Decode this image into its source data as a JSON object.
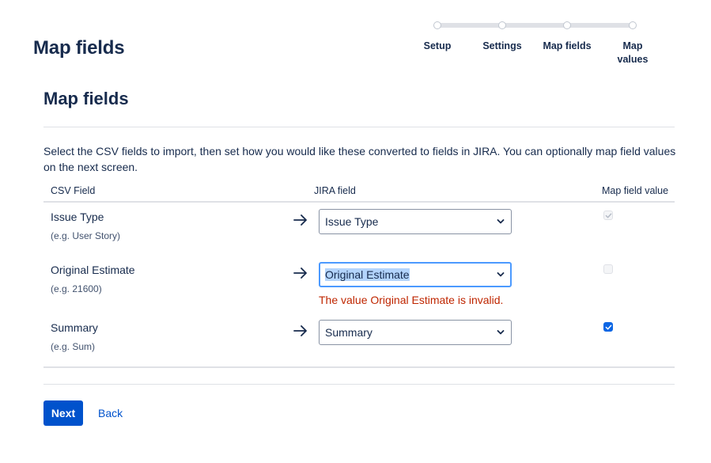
{
  "page": {
    "title": "Map fields"
  },
  "tracker": {
    "steps": [
      {
        "label": "Setup"
      },
      {
        "label": "Settings"
      },
      {
        "label": "Map fields"
      },
      {
        "label": "Map values"
      }
    ]
  },
  "section": {
    "title": "Map fields",
    "description": "Select the CSV fields to import, then set how you would like these converted to fields in JIRA. You can optionally map field values on the next screen."
  },
  "table": {
    "headers": {
      "csv_field": "CSV Field",
      "jira_field": "JIRA field",
      "map_value": "Map field value"
    },
    "rows": [
      {
        "csv_field": "Issue Type",
        "example": "(e.g. User Story)",
        "jira_field": "Issue Type",
        "map_value": "checked-disabled"
      },
      {
        "csv_field": "Original Estimate",
        "example": "(e.g. 21600)",
        "jira_field": "Original Estimate",
        "map_value": "unchecked-disabled",
        "error": "The value Original Estimate is invalid."
      },
      {
        "csv_field": "Summary",
        "example": "(e.g. Sum)",
        "jira_field": "Summary",
        "map_value": "checked"
      }
    ]
  },
  "actions": {
    "next_label": "Next",
    "back_label": "Back"
  },
  "colors": {
    "primary": "#0052cc",
    "error": "#bf2600",
    "focus": "#4c9aff",
    "text": "#172b4d"
  },
  "icons": {
    "arrow": "arrow-right-icon",
    "select_chevron": "chevron-down-icon",
    "checkmark": "check-icon"
  }
}
